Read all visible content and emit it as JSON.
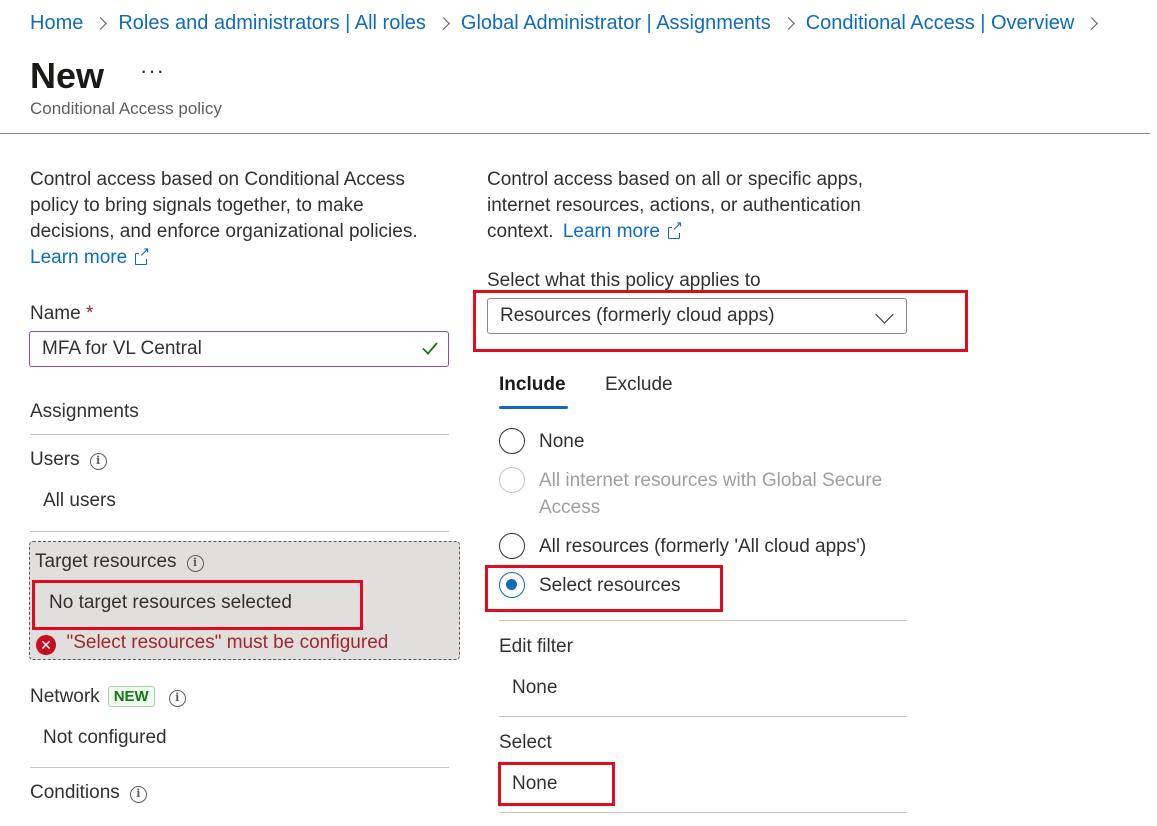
{
  "breadcrumb": {
    "items": [
      "Home",
      "Roles and administrators | All roles",
      "Global Administrator | Assignments",
      "Conditional Access | Overview"
    ]
  },
  "header": {
    "title": "New",
    "more": "···",
    "subtitle": "Conditional Access policy"
  },
  "left": {
    "intro_line1": "Control access based on Conditional Access",
    "intro_line2": "policy to bring signals together, to make",
    "intro_line3": "decisions, and enforce organizational policies.",
    "learn_more": "Learn more",
    "name_label": "Name",
    "name_required": "*",
    "name_value": "MFA for VL Central",
    "assignments_heading": "Assignments",
    "users_label": "Users",
    "users_value": "All users",
    "target_label": "Target resources",
    "target_value": "No target resources selected",
    "target_error": "\"Select resources\" must be configured",
    "network_label": "Network",
    "network_badge": "NEW",
    "network_value": "Not configured",
    "conditions_label": "Conditions"
  },
  "right": {
    "intro_line1": "Control access based on all or specific apps,",
    "intro_line2": "internet resources, actions, or authentication",
    "intro_line3": "context.",
    "learn_more": "Learn more",
    "applies_label": "Select what this policy applies to",
    "applies_value": "Resources (formerly cloud apps)",
    "tabs": [
      "Include",
      "Exclude"
    ],
    "options": [
      {
        "label": "None",
        "state": "unchecked"
      },
      {
        "label_line1": "All internet resources with Global Secure",
        "label_line2": "Access",
        "state": "disabled"
      },
      {
        "label": "All resources (formerly 'All cloud apps')",
        "state": "unchecked"
      },
      {
        "label": "Select resources",
        "state": "checked"
      }
    ],
    "edit_filter_label": "Edit filter",
    "edit_filter_value": "None",
    "select_label": "Select",
    "select_value": "None"
  },
  "colors": {
    "link": "#0f6cbd",
    "highlight": "#e00b1c",
    "error": "#a4262c",
    "success": "#107c10"
  }
}
